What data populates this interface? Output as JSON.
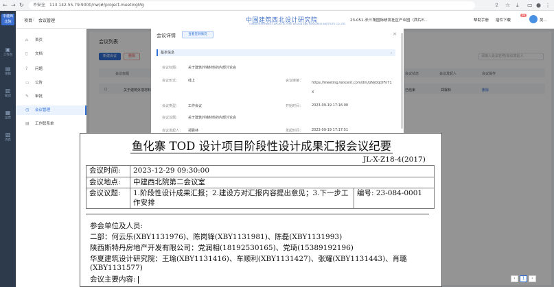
{
  "browser": {
    "security": "不安全",
    "url": "113.142.55.79:9000/nw/#/project-meetingMg"
  },
  "sidebar": {
    "logo": "中建西北院",
    "items": [
      {
        "label": "工作台"
      },
      {
        "label": "项目"
      },
      {
        "label": "知识"
      },
      {
        "label": "运营"
      },
      {
        "label": "消息"
      }
    ]
  },
  "header": {
    "breadcrumb_root": "项目",
    "breadcrumb_current": "会议管理",
    "brand": "中国建筑西北设计研究院",
    "brand_en": "CHINA NORTHWEST ARCHITECTURE DESIGN AND RESEARCH INSTITUTE CO.,LTD",
    "project": "23-051-长三角国际研发社区产业园（西片E...",
    "help": "帮助手册",
    "plugin": "插件下载",
    "badge": "99",
    "user": "吴..."
  },
  "leftnav": {
    "items": [
      {
        "label": "首页"
      },
      {
        "label": "文档"
      },
      {
        "label": "问题"
      },
      {
        "label": "公告"
      },
      {
        "label": "审批"
      },
      {
        "label": "会议管理"
      },
      {
        "label": "工作联系单"
      }
    ]
  },
  "list": {
    "title": "会议列表",
    "new_btn": "新建会议",
    "del_btn": "删除",
    "search_placeholder": "请输入会议名称/会议发起人",
    "columns": [
      "会议标题",
      "会议状态",
      "会议发起人",
      "会议操作"
    ],
    "row": {
      "title": "关于建筑外墙材料的内部讨论会",
      "status": "已结束",
      "initiator": "郑霖林",
      "action": "删除"
    }
  },
  "modal": {
    "title": "会议详情",
    "view_btn": "查看签到情况",
    "section": "基本信息",
    "fields": {
      "subject_label": "会议标题：",
      "subject": "关于建筑外墙材料的内部讨论会",
      "form_label": "会议形式：",
      "form": "线上",
      "link_label": "会议链接：",
      "link": "https://meeting.tencent.com/dm/pNs0qtXFn71X",
      "type_label": "会议类型：",
      "type": "工作会议",
      "start_label": "开始时间：",
      "start": "2023-09-19 17:16:00",
      "topic_label": "会议议题：",
      "topic": "关于建筑外墙材料的内部讨论会",
      "initiator_label": "会议发起人：",
      "initiator": "郑霖林",
      "issue_label": "发起时间：",
      "issue": "2023-09-19 17:17:51"
    }
  },
  "doc": {
    "title": "鱼化寨 TOD 设计项目阶段性设计成果汇报会议纪要",
    "code": "JL-X-Z18-4(2017)",
    "time_label": "会议时间:",
    "time": "2023-12-29 09:30:00",
    "place_label": "会议地点:",
    "place": "中建西北院第二会议室",
    "topic_label": "会议议题:",
    "topic": "1.阶段性设计成果汇报；2.建设方对汇报内容提出意见；3.下一步工作安排",
    "number": "编号: 23-084-0001",
    "attendees_label": "参会单位及人员:",
    "attendees": [
      "二部：何云乐(XBY1131976)、陈岗锋(XBY1131981)、陈磊(XBY1131993)",
      "陕西斯特丹房地产开发有限公司：党润相(18192530165)、党琦(15389192196)",
      "华夏建筑设计研究院：王瑜(XBY1131416)、车顺利(XBY1131427)、张耀(XBY1131443)、肖璐(XBY1131577)"
    ],
    "content_label": "会议主要内容:"
  },
  "pager": {
    "prev": "‹",
    "page": "1",
    "next": "›"
  }
}
